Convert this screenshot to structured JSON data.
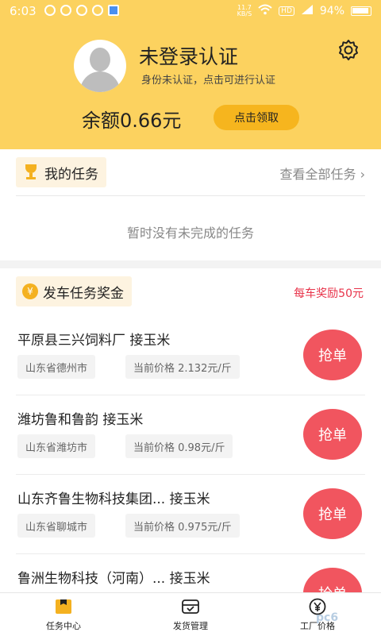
{
  "status_bar": {
    "time": "6:03",
    "speed": "11.7\nKB/S",
    "hd": "HD",
    "signal": "4G",
    "battery": "94%"
  },
  "profile": {
    "title": "未登录认证",
    "subtitle": "身份未认证，点击可进行认证",
    "balance": "余额0.66元",
    "claim_button": "点击领取"
  },
  "my_tasks": {
    "label": "我的任务",
    "view_all": "查看全部任务 ›",
    "empty_text": "暂时没有未完成的任务"
  },
  "dispatch": {
    "label": "发车任务奖金",
    "coin": "¥",
    "reward_text": "每车奖励50元"
  },
  "tasks": [
    {
      "title": "平原县三兴饲料厂  接玉米",
      "location": "山东省德州市",
      "price": "当前价格 2.132元/斤",
      "button": "抢单"
    },
    {
      "title": "潍坊鲁和鲁韵  接玉米",
      "location": "山东省潍坊市",
      "price": "当前价格 0.98元/斤",
      "button": "抢单"
    },
    {
      "title": "山东齐鲁生物科技集团...  接玉米",
      "location": "山东省聊城市",
      "price": "当前价格 0.975元/斤",
      "button": "抢单"
    },
    {
      "title": "鲁洲生物科技（河南）...  接玉米",
      "location": "",
      "price": "",
      "button": "抢单"
    }
  ],
  "nav": {
    "items": [
      {
        "label": "任务中心"
      },
      {
        "label": "发货管理"
      },
      {
        "label": "工厂价格"
      }
    ]
  },
  "watermark": "pc6"
}
